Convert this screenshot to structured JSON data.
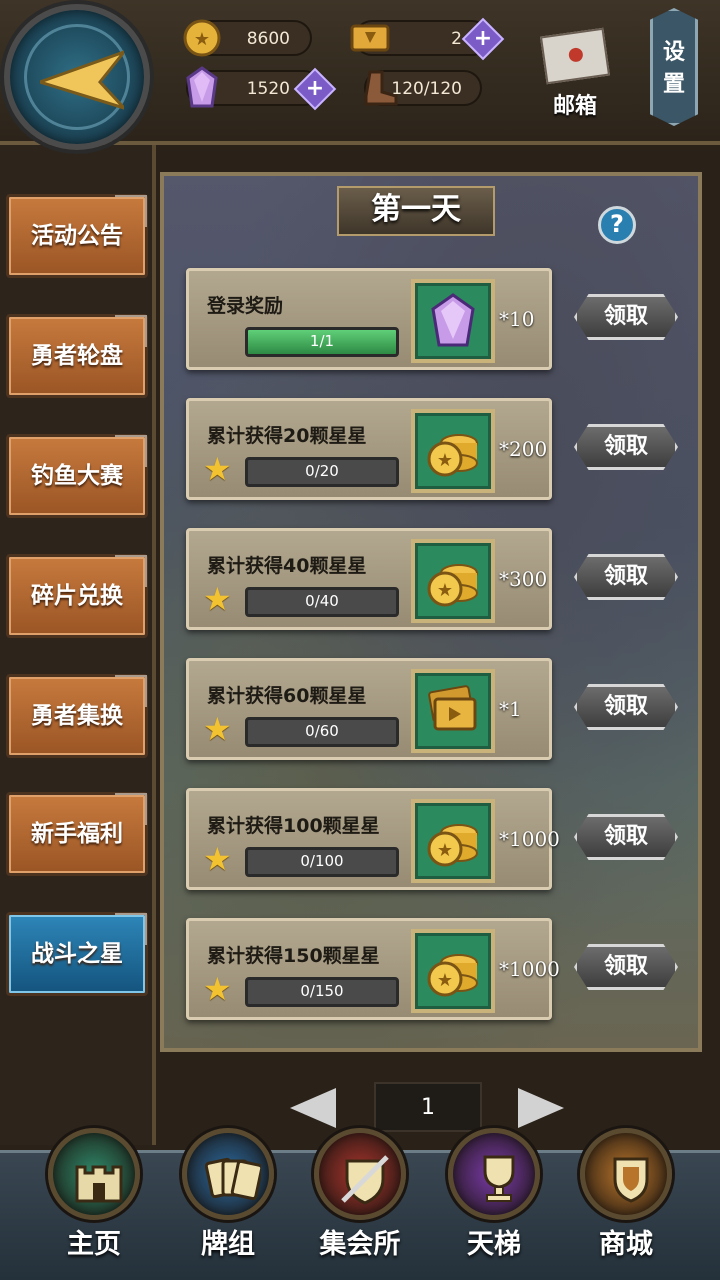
{
  "currency": {
    "gold": "8600",
    "tickets": "2",
    "crystals": "1520",
    "stamina": "120/120"
  },
  "header": {
    "mail_label": "邮箱",
    "settings_label_1": "设",
    "settings_label_2": "置"
  },
  "sidebar": {
    "items": [
      {
        "label": "活动公告",
        "active": false
      },
      {
        "label": "勇者轮盘",
        "active": false
      },
      {
        "label": "钓鱼大赛",
        "active": false
      },
      {
        "label": "碎片兑换",
        "active": false
      },
      {
        "label": "勇者集换",
        "active": false
      },
      {
        "label": "新手福利",
        "active": false
      },
      {
        "label": "战斗之星",
        "active": true
      }
    ]
  },
  "panel": {
    "day_title": "第一天",
    "help_icon": "?",
    "tasks": [
      {
        "title": "登录奖励",
        "progress": "1/1",
        "progress_fraction": 1,
        "reward_icon": "crystal-icon",
        "quantity": "*10",
        "claim_label": "领取",
        "show_star": false
      },
      {
        "title": "累计获得20颗星星",
        "progress": "0/20",
        "progress_fraction": 0,
        "reward_icon": "gold-coins-icon",
        "quantity": "*200",
        "claim_label": "领取",
        "show_star": true
      },
      {
        "title": "累计获得40颗星星",
        "progress": "0/40",
        "progress_fraction": 0,
        "reward_icon": "gold-coins-icon",
        "quantity": "*300",
        "claim_label": "领取",
        "show_star": true
      },
      {
        "title": "累计获得60颗星星",
        "progress": "0/60",
        "progress_fraction": 0,
        "reward_icon": "ticket-icon",
        "quantity": "*1",
        "claim_label": "领取",
        "show_star": true
      },
      {
        "title": "累计获得100颗星星",
        "progress": "0/100",
        "progress_fraction": 0,
        "reward_icon": "gold-coins-icon",
        "quantity": "*1000",
        "claim_label": "领取",
        "show_star": true
      },
      {
        "title": "累计获得150颗星星",
        "progress": "0/150",
        "progress_fraction": 0,
        "reward_icon": "gold-coins-icon",
        "quantity": "*1000",
        "claim_label": "领取",
        "show_star": true
      }
    ]
  },
  "pager": {
    "current_page": "1"
  },
  "bottom_nav": {
    "items": [
      {
        "label": "主页",
        "icon": "castle-icon",
        "color": "#2f8a6a"
      },
      {
        "label": "牌组",
        "icon": "cards-icon",
        "color": "#2a6aa0"
      },
      {
        "label": "集会所",
        "icon": "shield-sword-icon",
        "color": "#a8342c"
      },
      {
        "label": "天梯",
        "icon": "trophy-icon",
        "color": "#7a3aa8"
      },
      {
        "label": "商城",
        "icon": "shop-sign-icon",
        "color": "#b8742a"
      }
    ]
  },
  "colors": {
    "active_tab": "#14547e",
    "inactive_tab": "#9a5525",
    "progress_fill": "#2e8a44",
    "reward_slot": "#2b8a5e"
  }
}
